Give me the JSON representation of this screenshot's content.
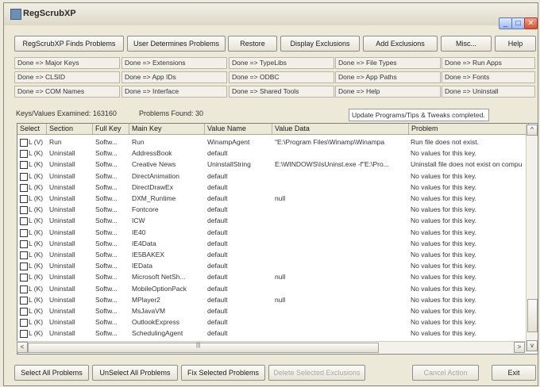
{
  "window": {
    "title": "RegScrubXP",
    "minimize": "_",
    "maximize": "□",
    "close": "✕"
  },
  "toolbar": {
    "finds": "RegScrubXP Finds Problems",
    "user": "User Determines Problems",
    "restore": "Restore",
    "display": "Display Exclusions",
    "add": "Add Exclusions",
    "misc": "Misc...",
    "help": "Help"
  },
  "status_grid": [
    "Done => Major Keys",
    "Done => Extensions",
    "Done => TypeLibs",
    "Done => File Types",
    "Done => Run Apps",
    "Done => CLSID",
    "Done => App IDs",
    "Done => ODBC",
    "Done => App Paths",
    "Done => Fonts",
    "Done => COM Names",
    "Done => Interface",
    "Done => Shared Tools",
    "Done => Help",
    "Done => Uninstall"
  ],
  "summary": {
    "examined": "Keys/Values Examined: 163160",
    "problems": "Problems Found: 30",
    "status": "Update Programs/Tips & Tweaks completed."
  },
  "columns": [
    "Select",
    "Section",
    "Full Key",
    "Main Key",
    "Value Name",
    "Value Data",
    "Problem"
  ],
  "rows": [
    {
      "sel": "L (V)",
      "section": "Run",
      "full": "Softw...",
      "main": "Run",
      "vname": "WinampAgent",
      "vdata": "\"E:\\Program Files\\Winamp\\Winampa",
      "problem": "Run file does not exist."
    },
    {
      "sel": "L (K)",
      "section": "Uninstall",
      "full": "Softw...",
      "main": "AddressBook",
      "vname": "default",
      "vdata": "",
      "problem": "No values for this key."
    },
    {
      "sel": "L (K)",
      "section": "Uninstall",
      "full": "Softw...",
      "main": "Creative News",
      "vname": "UninstallString",
      "vdata": "E:\\WINDOWS\\IsUninst.exe -f\"E:\\Pro...",
      "problem": "Uninstall file does not exist on compu"
    },
    {
      "sel": "L (K)",
      "section": "Uninstall",
      "full": "Softw...",
      "main": "DirectAnimation",
      "vname": "default",
      "vdata": "",
      "problem": "No values for this key."
    },
    {
      "sel": "L (K)",
      "section": "Uninstall",
      "full": "Softw...",
      "main": "DirectDrawEx",
      "vname": "default",
      "vdata": "",
      "problem": "No values for this key."
    },
    {
      "sel": "L (K)",
      "section": "Uninstall",
      "full": "Softw...",
      "main": "DXM_Runtime",
      "vname": "default",
      "vdata": "null",
      "problem": "No values for this key."
    },
    {
      "sel": "L (K)",
      "section": "Uninstall",
      "full": "Softw...",
      "main": "Fontcore",
      "vname": "default",
      "vdata": "",
      "problem": "No values for this key."
    },
    {
      "sel": "L (K)",
      "section": "Uninstall",
      "full": "Softw...",
      "main": "ICW",
      "vname": "default",
      "vdata": "",
      "problem": "No values for this key."
    },
    {
      "sel": "L (K)",
      "section": "Uninstall",
      "full": "Softw...",
      "main": "IE40",
      "vname": "default",
      "vdata": "",
      "problem": "No values for this key."
    },
    {
      "sel": "L (K)",
      "section": "Uninstall",
      "full": "Softw...",
      "main": "IE4Data",
      "vname": "default",
      "vdata": "",
      "problem": "No values for this key."
    },
    {
      "sel": "L (K)",
      "section": "Uninstall",
      "full": "Softw...",
      "main": "IE5BAKEX",
      "vname": "default",
      "vdata": "",
      "problem": "No values for this key."
    },
    {
      "sel": "L (K)",
      "section": "Uninstall",
      "full": "Softw...",
      "main": "IEData",
      "vname": "default",
      "vdata": "",
      "problem": "No values for this key."
    },
    {
      "sel": "L (K)",
      "section": "Uninstall",
      "full": "Softw...",
      "main": "Microsoft NetSh...",
      "vname": "default",
      "vdata": "null",
      "problem": "No values for this key."
    },
    {
      "sel": "L (K)",
      "section": "Uninstall",
      "full": "Softw...",
      "main": "MobileOptionPack",
      "vname": "default",
      "vdata": "",
      "problem": "No values for this key."
    },
    {
      "sel": "L (K)",
      "section": "Uninstall",
      "full": "Softw...",
      "main": "MPlayer2",
      "vname": "default",
      "vdata": "null",
      "problem": "No values for this key."
    },
    {
      "sel": "L (K)",
      "section": "Uninstall",
      "full": "Softw...",
      "main": "MsJavaVM",
      "vname": "default",
      "vdata": "",
      "problem": "No values for this key."
    },
    {
      "sel": "L (K)",
      "section": "Uninstall",
      "full": "Softw...",
      "main": "OutlookExpress",
      "vname": "default",
      "vdata": "",
      "problem": "No values for this key."
    },
    {
      "sel": "L (K)",
      "section": "Uninstall",
      "full": "Softw...",
      "main": "SchedulingAgent",
      "vname": "default",
      "vdata": "",
      "problem": "No values for this key."
    }
  ],
  "scroll": {
    "left": "<",
    "right": ">",
    "up": "^",
    "down": "v",
    "grip": "|||"
  },
  "bottom": {
    "select_all": "Select All Problems",
    "unselect_all": "UnSelect All Problems",
    "fix": "Fix Selected Problems",
    "delete": "Delete Selected Exclusions",
    "cancel": "Cancel Action",
    "exit": "Exit"
  }
}
